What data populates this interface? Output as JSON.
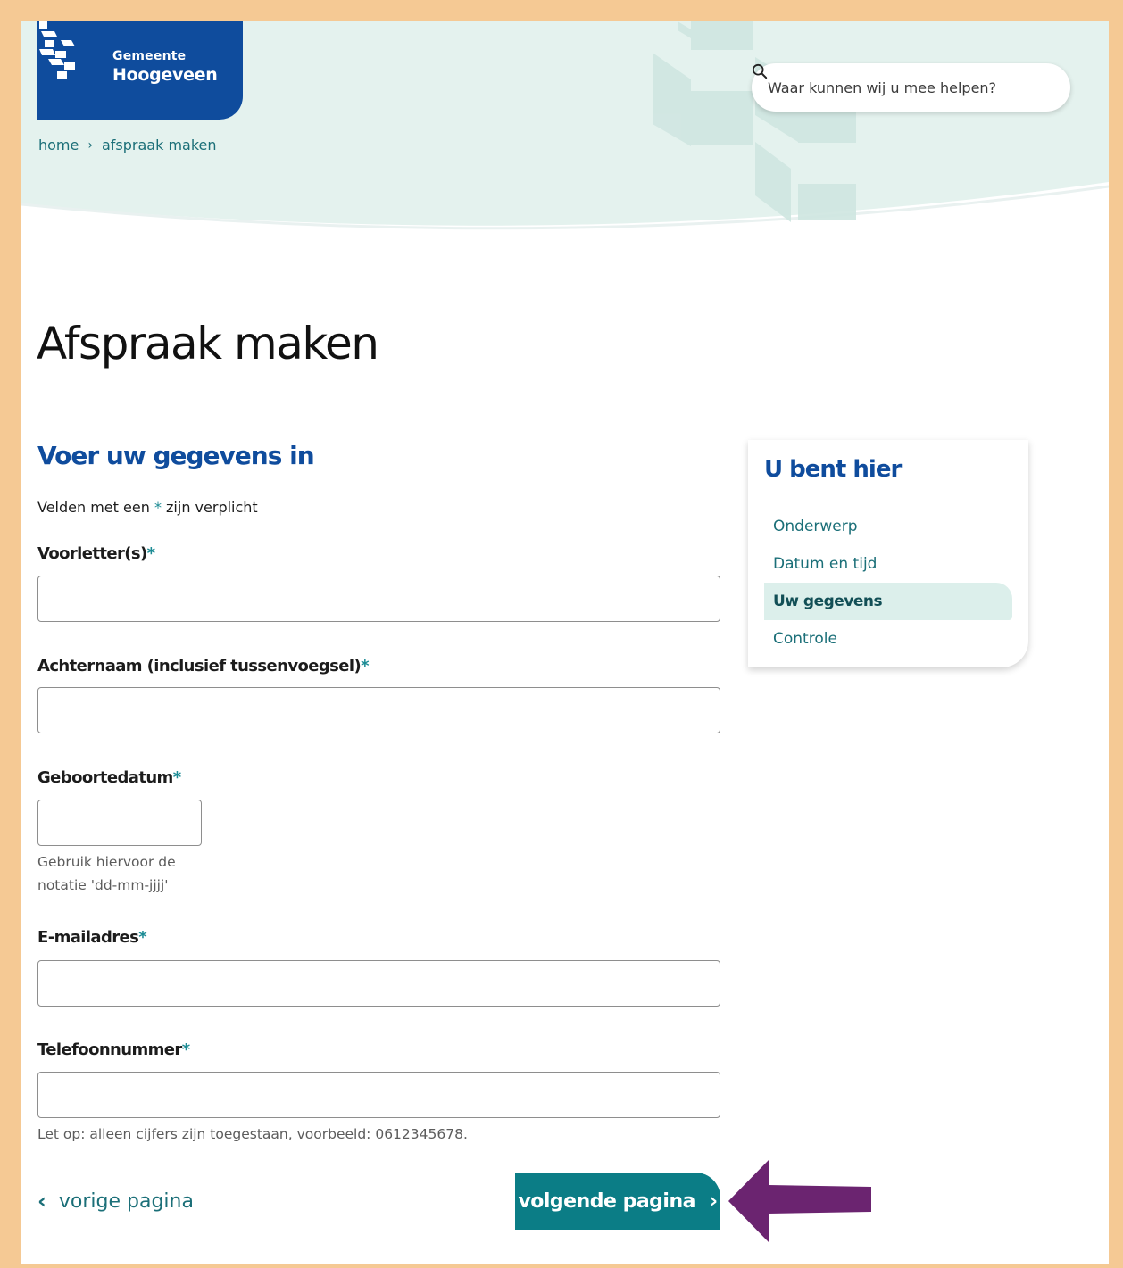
{
  "site": {
    "brand_line_1": "Gemeente",
    "brand_line_2": "Hoogeveen"
  },
  "search": {
    "placeholder": "Waar kunnen wij u mee helpen?"
  },
  "breadcrumb": {
    "home": "home",
    "separator": "›",
    "current": "afspraak maken"
  },
  "page": {
    "title": "Afspraak maken"
  },
  "form": {
    "section_title": "Voer uw gegevens in",
    "required_note_prefix": "Velden met een",
    "required_star": "*",
    "required_note_suffix": "zijn verplicht",
    "fields": [
      {
        "label": "Voorletter(s)",
        "value": "",
        "hint": ""
      },
      {
        "label": "Achternaam (inclusief tussenvoegsel)",
        "value": "",
        "hint": ""
      },
      {
        "label": "Geboortedatum",
        "value": "",
        "hint_line_1": "Gebruik hiervoor de",
        "hint_line_2": "notatie 'dd-mm-jjjj'"
      },
      {
        "label": "E-mailadres",
        "value": "",
        "hint": ""
      },
      {
        "label": "Telefoonnummer",
        "value": "",
        "hint": "Let op: alleen cijfers zijn toegestaan, voorbeeld: 0612345678."
      }
    ]
  },
  "nav": {
    "prev_label": "vorige pagina",
    "prev_icon": "‹",
    "next_label": "volgende pagina",
    "next_icon": "›"
  },
  "steps": {
    "title": "U bent hier",
    "items": [
      {
        "label": "Onderwerp",
        "active": false
      },
      {
        "label": "Datum en tijd",
        "active": false
      },
      {
        "label": "Uw gegevens",
        "active": true
      },
      {
        "label": "Controle",
        "active": false
      }
    ]
  },
  "colors": {
    "brand_blue": "#0f4c9d",
    "teal": "#0b7d86",
    "link": "#1b6f78",
    "hero_bg": "#e4f2ee",
    "annotation_arrow": "#6b2470",
    "frame": "#f5c994"
  },
  "icons": {
    "search": "search-icon",
    "annotation": "arrow-left-icon"
  }
}
